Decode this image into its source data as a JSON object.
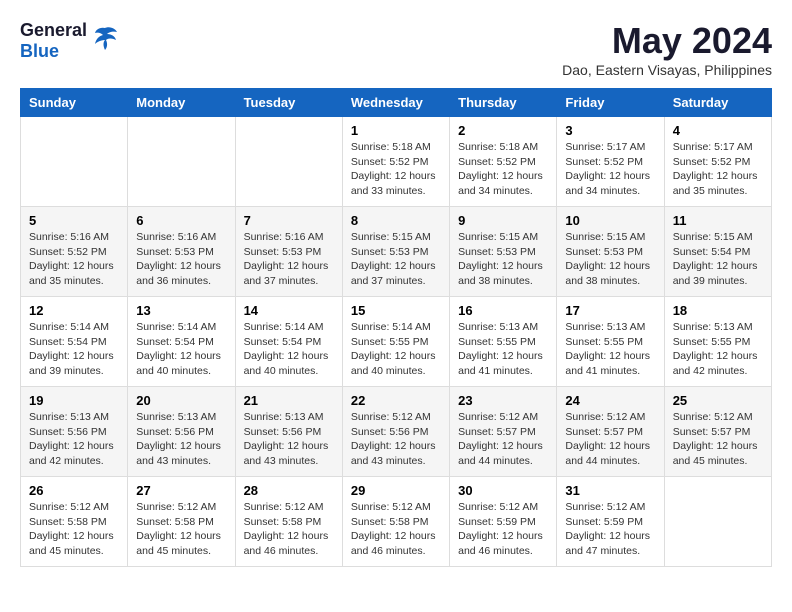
{
  "logo": {
    "general": "General",
    "blue": "Blue"
  },
  "title": "May 2024",
  "subtitle": "Dao, Eastern Visayas, Philippines",
  "calendar": {
    "headers": [
      "Sunday",
      "Monday",
      "Tuesday",
      "Wednesday",
      "Thursday",
      "Friday",
      "Saturday"
    ],
    "weeks": [
      [
        {
          "day": "",
          "info": ""
        },
        {
          "day": "",
          "info": ""
        },
        {
          "day": "",
          "info": ""
        },
        {
          "day": "1",
          "info": "Sunrise: 5:18 AM\nSunset: 5:52 PM\nDaylight: 12 hours\nand 33 minutes."
        },
        {
          "day": "2",
          "info": "Sunrise: 5:18 AM\nSunset: 5:52 PM\nDaylight: 12 hours\nand 34 minutes."
        },
        {
          "day": "3",
          "info": "Sunrise: 5:17 AM\nSunset: 5:52 PM\nDaylight: 12 hours\nand 34 minutes."
        },
        {
          "day": "4",
          "info": "Sunrise: 5:17 AM\nSunset: 5:52 PM\nDaylight: 12 hours\nand 35 minutes."
        }
      ],
      [
        {
          "day": "5",
          "info": "Sunrise: 5:16 AM\nSunset: 5:52 PM\nDaylight: 12 hours\nand 35 minutes."
        },
        {
          "day": "6",
          "info": "Sunrise: 5:16 AM\nSunset: 5:53 PM\nDaylight: 12 hours\nand 36 minutes."
        },
        {
          "day": "7",
          "info": "Sunrise: 5:16 AM\nSunset: 5:53 PM\nDaylight: 12 hours\nand 37 minutes."
        },
        {
          "day": "8",
          "info": "Sunrise: 5:15 AM\nSunset: 5:53 PM\nDaylight: 12 hours\nand 37 minutes."
        },
        {
          "day": "9",
          "info": "Sunrise: 5:15 AM\nSunset: 5:53 PM\nDaylight: 12 hours\nand 38 minutes."
        },
        {
          "day": "10",
          "info": "Sunrise: 5:15 AM\nSunset: 5:53 PM\nDaylight: 12 hours\nand 38 minutes."
        },
        {
          "day": "11",
          "info": "Sunrise: 5:15 AM\nSunset: 5:54 PM\nDaylight: 12 hours\nand 39 minutes."
        }
      ],
      [
        {
          "day": "12",
          "info": "Sunrise: 5:14 AM\nSunset: 5:54 PM\nDaylight: 12 hours\nand 39 minutes."
        },
        {
          "day": "13",
          "info": "Sunrise: 5:14 AM\nSunset: 5:54 PM\nDaylight: 12 hours\nand 40 minutes."
        },
        {
          "day": "14",
          "info": "Sunrise: 5:14 AM\nSunset: 5:54 PM\nDaylight: 12 hours\nand 40 minutes."
        },
        {
          "day": "15",
          "info": "Sunrise: 5:14 AM\nSunset: 5:55 PM\nDaylight: 12 hours\nand 40 minutes."
        },
        {
          "day": "16",
          "info": "Sunrise: 5:13 AM\nSunset: 5:55 PM\nDaylight: 12 hours\nand 41 minutes."
        },
        {
          "day": "17",
          "info": "Sunrise: 5:13 AM\nSunset: 5:55 PM\nDaylight: 12 hours\nand 41 minutes."
        },
        {
          "day": "18",
          "info": "Sunrise: 5:13 AM\nSunset: 5:55 PM\nDaylight: 12 hours\nand 42 minutes."
        }
      ],
      [
        {
          "day": "19",
          "info": "Sunrise: 5:13 AM\nSunset: 5:56 PM\nDaylight: 12 hours\nand 42 minutes."
        },
        {
          "day": "20",
          "info": "Sunrise: 5:13 AM\nSunset: 5:56 PM\nDaylight: 12 hours\nand 43 minutes."
        },
        {
          "day": "21",
          "info": "Sunrise: 5:13 AM\nSunset: 5:56 PM\nDaylight: 12 hours\nand 43 minutes."
        },
        {
          "day": "22",
          "info": "Sunrise: 5:12 AM\nSunset: 5:56 PM\nDaylight: 12 hours\nand 43 minutes."
        },
        {
          "day": "23",
          "info": "Sunrise: 5:12 AM\nSunset: 5:57 PM\nDaylight: 12 hours\nand 44 minutes."
        },
        {
          "day": "24",
          "info": "Sunrise: 5:12 AM\nSunset: 5:57 PM\nDaylight: 12 hours\nand 44 minutes."
        },
        {
          "day": "25",
          "info": "Sunrise: 5:12 AM\nSunset: 5:57 PM\nDaylight: 12 hours\nand 45 minutes."
        }
      ],
      [
        {
          "day": "26",
          "info": "Sunrise: 5:12 AM\nSunset: 5:58 PM\nDaylight: 12 hours\nand 45 minutes."
        },
        {
          "day": "27",
          "info": "Sunrise: 5:12 AM\nSunset: 5:58 PM\nDaylight: 12 hours\nand 45 minutes."
        },
        {
          "day": "28",
          "info": "Sunrise: 5:12 AM\nSunset: 5:58 PM\nDaylight: 12 hours\nand 46 minutes."
        },
        {
          "day": "29",
          "info": "Sunrise: 5:12 AM\nSunset: 5:58 PM\nDaylight: 12 hours\nand 46 minutes."
        },
        {
          "day": "30",
          "info": "Sunrise: 5:12 AM\nSunset: 5:59 PM\nDaylight: 12 hours\nand 46 minutes."
        },
        {
          "day": "31",
          "info": "Sunrise: 5:12 AM\nSunset: 5:59 PM\nDaylight: 12 hours\nand 47 minutes."
        },
        {
          "day": "",
          "info": ""
        }
      ]
    ]
  }
}
